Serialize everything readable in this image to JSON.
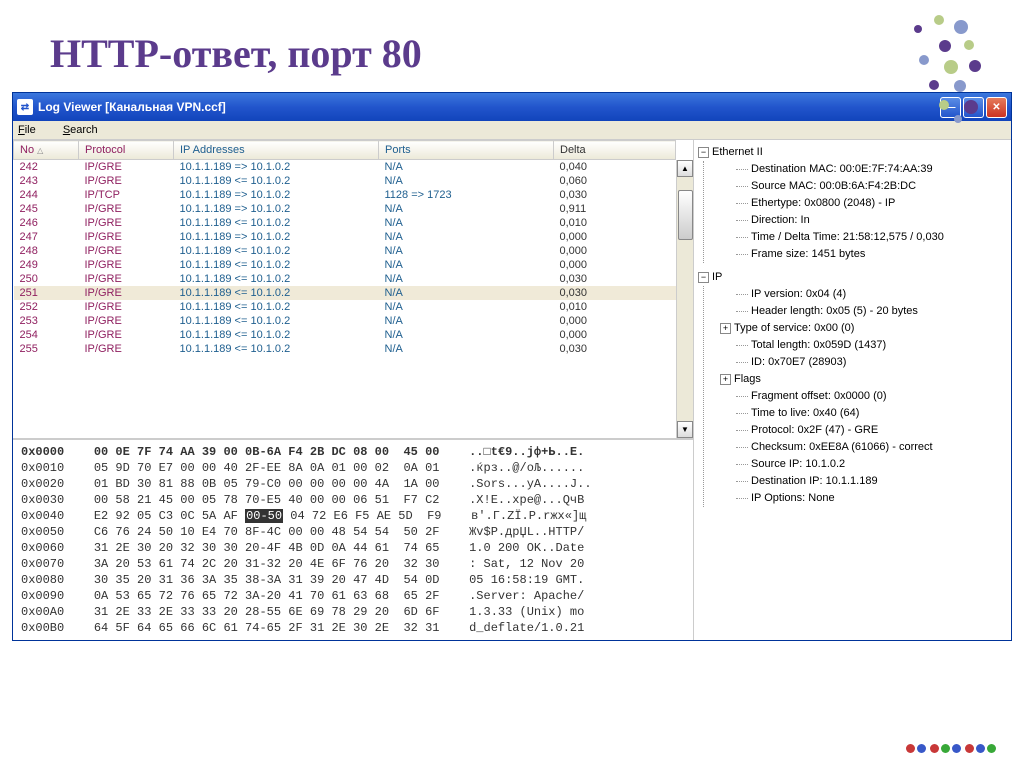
{
  "heading": "HTTP-ответ, порт 80",
  "window": {
    "title": "Log Viewer [Канальная VPN.ccf]",
    "titlebar_icon": "⇄"
  },
  "menubar": {
    "file": "File",
    "search": "Search"
  },
  "table": {
    "headers": {
      "no": "No",
      "protocol": "Protocol",
      "ip": "IP Addresses",
      "ports": "Ports",
      "delta": "Delta"
    },
    "rows": [
      {
        "no": "242",
        "proto": "IP/GRE",
        "ip": "10.1.1.189 => 10.1.0.2",
        "ports": "N/A",
        "delta": "0,040"
      },
      {
        "no": "243",
        "proto": "IP/GRE",
        "ip": "10.1.1.189 <= 10.1.0.2",
        "ports": "N/A",
        "delta": "0,060"
      },
      {
        "no": "244",
        "proto": "IP/TCP",
        "ip": "10.1.1.189 => 10.1.0.2",
        "ports": "1128 => 1723",
        "delta": "0,030"
      },
      {
        "no": "245",
        "proto": "IP/GRE",
        "ip": "10.1.1.189 => 10.1.0.2",
        "ports": "N/A",
        "delta": "0,911"
      },
      {
        "no": "246",
        "proto": "IP/GRE",
        "ip": "10.1.1.189 <= 10.1.0.2",
        "ports": "N/A",
        "delta": "0,010"
      },
      {
        "no": "247",
        "proto": "IP/GRE",
        "ip": "10.1.1.189 => 10.1.0.2",
        "ports": "N/A",
        "delta": "0,000"
      },
      {
        "no": "248",
        "proto": "IP/GRE",
        "ip": "10.1.1.189 <= 10.1.0.2",
        "ports": "N/A",
        "delta": "0,000"
      },
      {
        "no": "249",
        "proto": "IP/GRE",
        "ip": "10.1.1.189 <= 10.1.0.2",
        "ports": "N/A",
        "delta": "0,000"
      },
      {
        "no": "250",
        "proto": "IP/GRE",
        "ip": "10.1.1.189 <= 10.1.0.2",
        "ports": "N/A",
        "delta": "0,030"
      },
      {
        "no": "251",
        "proto": "IP/GRE",
        "ip": "10.1.1.189 <= 10.1.0.2",
        "ports": "N/A",
        "delta": "0,030",
        "selected": true
      },
      {
        "no": "252",
        "proto": "IP/GRE",
        "ip": "10.1.1.189 <= 10.1.0.2",
        "ports": "N/A",
        "delta": "0,010"
      },
      {
        "no": "253",
        "proto": "IP/GRE",
        "ip": "10.1.1.189 <= 10.1.0.2",
        "ports": "N/A",
        "delta": "0,000"
      },
      {
        "no": "254",
        "proto": "IP/GRE",
        "ip": "10.1.1.189 <= 10.1.0.2",
        "ports": "N/A",
        "delta": "0,000"
      },
      {
        "no": "255",
        "proto": "IP/GRE",
        "ip": "10.1.1.189 <= 10.1.0.2",
        "ports": "N/A",
        "delta": "0,030"
      }
    ]
  },
  "hex": [
    {
      "offset": "0x0000",
      "bytes": "00 0E 7F 74 AA 39 00 0B-6A F4 2B DC 08 00  45 00",
      "ascii": "..□t€9..jф+Ь..E."
    },
    {
      "offset": "0x0010",
      "bytes": "05 9D 70 E7 00 00 40 2F-EE 8A 0A 01 00 02  0A 01",
      "ascii": ".ќpз..@/оЉ......"
    },
    {
      "offset": "0x0020",
      "bytes": "01 BD 30 81 88 0B 05 79-C0 00 00 00 00 4A  1A 00",
      "ascii": ".Sorѕ...yА....J.."
    },
    {
      "offset": "0x0030",
      "bytes": "00 58 21 45 00 05 78 70-E5 40 00 00 06 51  F7 C2",
      "ascii": ".X!E..xpе@...QчВ"
    },
    {
      "offset": "0x0040",
      "bytes": "E2 92 05 C3 0C 5A AF ",
      "hl": "00-50",
      "bytes2": " 04 72 E6 F5 AE 5D  F9",
      "ascii": "в'.Г.ZЇ.P.rжх«]щ"
    },
    {
      "offset": "0x0050",
      "bytes": "C6 76 24 50 10 E4 70 8F-4C 00 00 48 54 54  50 2F",
      "ascii": "Жv$P.дpЏL..HTTP/"
    },
    {
      "offset": "0x0060",
      "bytes": "31 2E 30 20 32 30 30 20-4F 4B 0D 0A 44 61  74 65",
      "ascii": "1.0 200 OK..Date"
    },
    {
      "offset": "0x0070",
      "bytes": "3A 20 53 61 74 2C 20 31-32 20 4E 6F 76 20  32 30",
      "ascii": ": Sat, 12 Nov 20"
    },
    {
      "offset": "0x0080",
      "bytes": "30 35 20 31 36 3A 35 38-3A 31 39 20 47 4D  54 0D",
      "ascii": "05 16:58:19 GMT."
    },
    {
      "offset": "0x0090",
      "bytes": "0A 53 65 72 76 65 72 3A-20 41 70 61 63 68  65 2F",
      "ascii": ".Server: Apache/"
    },
    {
      "offset": "0x00A0",
      "bytes": "31 2E 33 2E 33 33 20 28-55 6E 69 78 29 20  6D 6F",
      "ascii": "1.3.33 (Unix) mo"
    },
    {
      "offset": "0x00B0",
      "bytes": "64 5F 64 65 66 6C 61 74-65 2F 31 2E 30 2E  32 31",
      "ascii": "d_deflate/1.0.21"
    }
  ],
  "tree": {
    "eth": {
      "label": "Ethernet II",
      "items": [
        "Destination MAC: 00:0E:7F:74:AA:39",
        "Source MAC: 00:0B:6A:F4:2B:DC",
        "Ethertype: 0x0800 (2048) - IP",
        "Direction: In",
        "Time / Delta Time: 21:58:12,575 / 0,030",
        "Frame size: 1451 bytes"
      ]
    },
    "ip": {
      "label": "IP",
      "items": [
        {
          "text": "IP version: 0x04 (4)"
        },
        {
          "text": "Header length: 0x05 (5) - 20 bytes"
        },
        {
          "text": "Type of service: 0x00 (0)",
          "expand": true
        },
        {
          "text": "Total length: 0x059D (1437)"
        },
        {
          "text": "ID: 0x70E7 (28903)"
        },
        {
          "text": "Flags",
          "expand": true
        },
        {
          "text": "Fragment offset: 0x0000 (0)"
        },
        {
          "text": "Time to live: 0x40 (64)"
        },
        {
          "text": "Protocol: 0x2F (47) - GRE"
        },
        {
          "text": "Checksum: 0xEE8A (61066) - correct"
        },
        {
          "text": "Source IP: 10.1.0.2"
        },
        {
          "text": "Destination IP: 10.1.1.189"
        },
        {
          "text": "IP Options: None"
        }
      ]
    }
  }
}
